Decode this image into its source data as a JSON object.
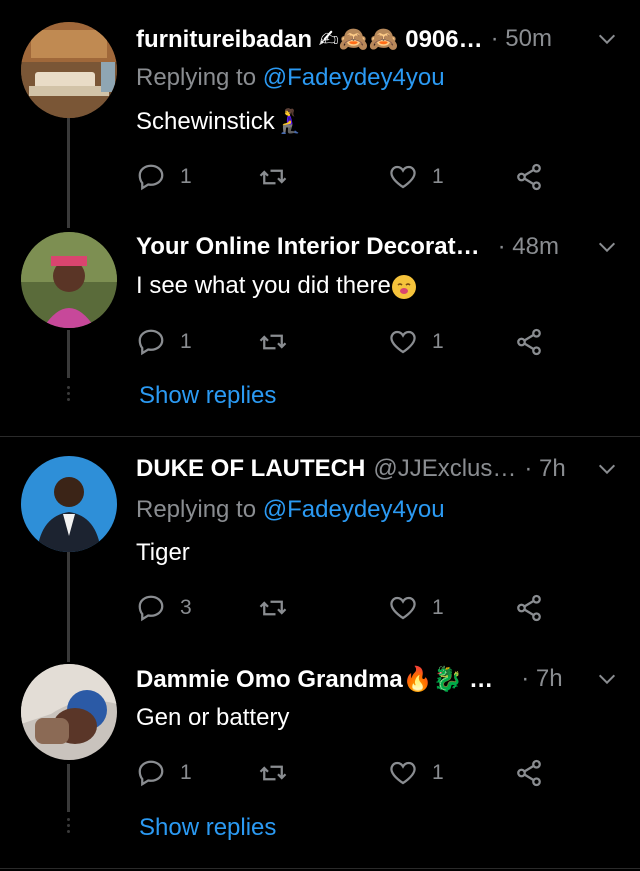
{
  "tweets": [
    {
      "name": "furnitureibadan ✍🙈🙈 0906…",
      "handle": "",
      "time": "· 50m",
      "reply_prefix": "Replying to",
      "reply_mention": "@Fadeydey4you",
      "text": "Schewinstick🧎‍♀️",
      "replies": "1",
      "retweets": "",
      "likes": "1"
    },
    {
      "name": "Your Online Interior Decorat…",
      "handle": "",
      "time": "· 48m",
      "text": "I see what you did there",
      "replies": "1",
      "retweets": "",
      "likes": "1",
      "show_replies": "Show replies"
    },
    {
      "name": "DUKE OF LAUTECH",
      "handle": "@JJExclus…",
      "time": "· 7h",
      "reply_prefix": "Replying to",
      "reply_mention": "@Fadeydey4you",
      "text": "Tiger",
      "replies": "3",
      "retweets": "",
      "likes": "1"
    },
    {
      "name": "Dammie Omo Grandma🔥🐉 …",
      "handle": "",
      "time": "· 7h",
      "text": "Gen or battery",
      "replies": "1",
      "retweets": "",
      "likes": "1",
      "show_replies": "Show replies"
    }
  ],
  "colors": {
    "background": "#000000",
    "link": "#2b9af3",
    "muted": "#8a8d91",
    "line": "#3a3a3a"
  }
}
